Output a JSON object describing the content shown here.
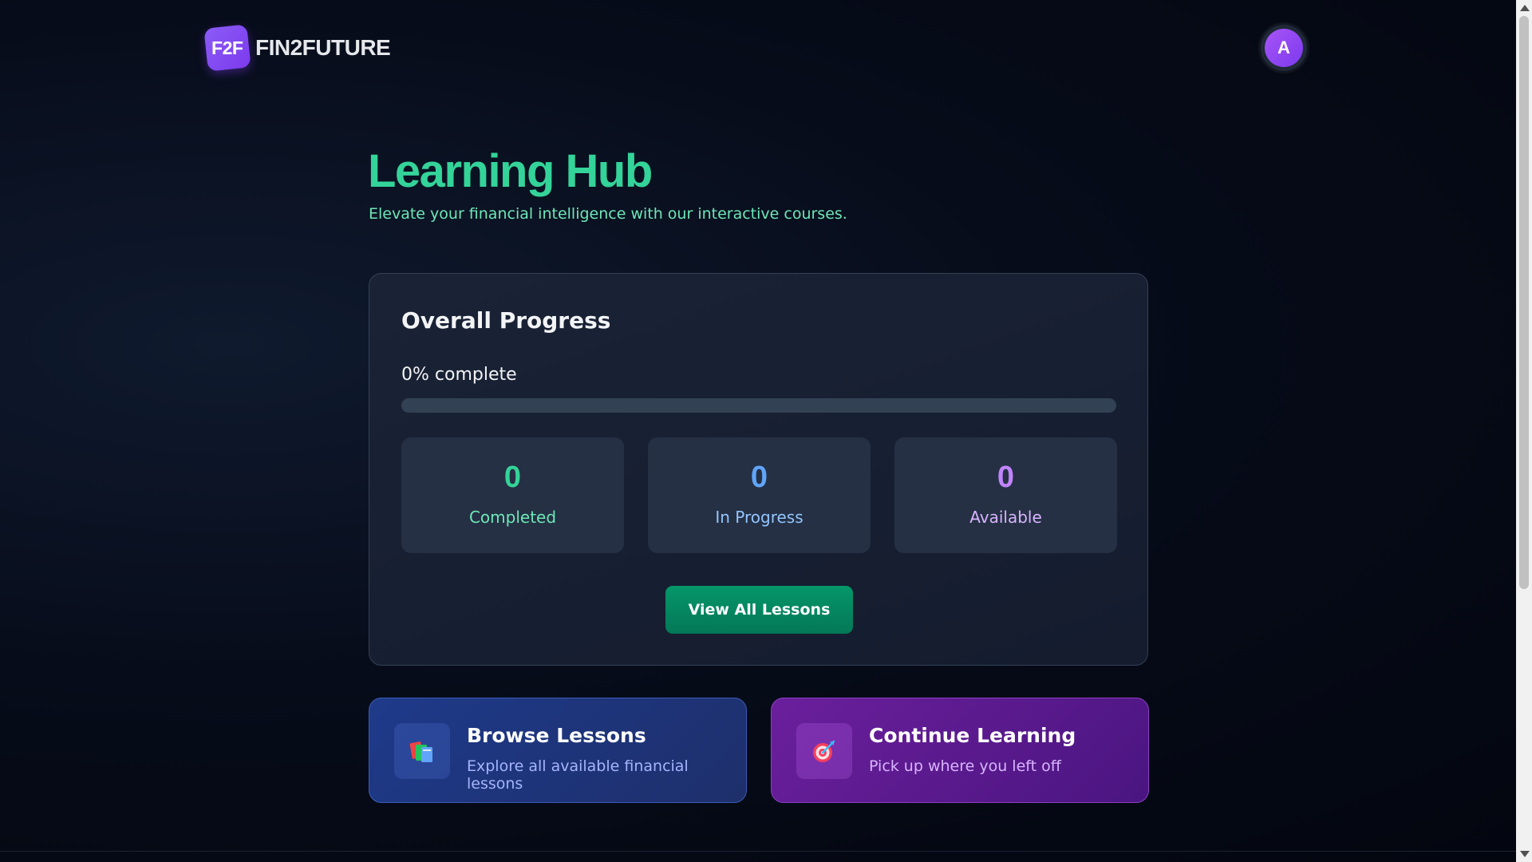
{
  "header": {
    "logo_badge": "F2F",
    "logo_text": "FIN2FUTURE",
    "avatar_initial": "A"
  },
  "hero": {
    "title": "Learning Hub",
    "subtitle": "Elevate your financial intelligence with our interactive courses."
  },
  "progress": {
    "title": "Overall Progress",
    "percent_label": "0% complete",
    "percent_value": 0,
    "stats": [
      {
        "value": "0",
        "label": "Completed",
        "value_color": "#34d399",
        "label_color": "#6ee7b7"
      },
      {
        "value": "0",
        "label": "In Progress",
        "value_color": "#60a5fa",
        "label_color": "#93c5fd"
      },
      {
        "value": "0",
        "label": "Available",
        "value_color": "#c084fc",
        "label_color": "#d8b4fe"
      }
    ],
    "button_label": "View All Lessons"
  },
  "tiles": [
    {
      "icon": "books-icon",
      "title": "Browse Lessons",
      "description": "Explore all available financial lessons"
    },
    {
      "icon": "target-icon",
      "title": "Continue Learning",
      "description": "Pick up where you left off"
    }
  ],
  "colors": {
    "accent_green": "#34d399",
    "button_green": "#059669",
    "brand_purple": "#7c3aed"
  }
}
